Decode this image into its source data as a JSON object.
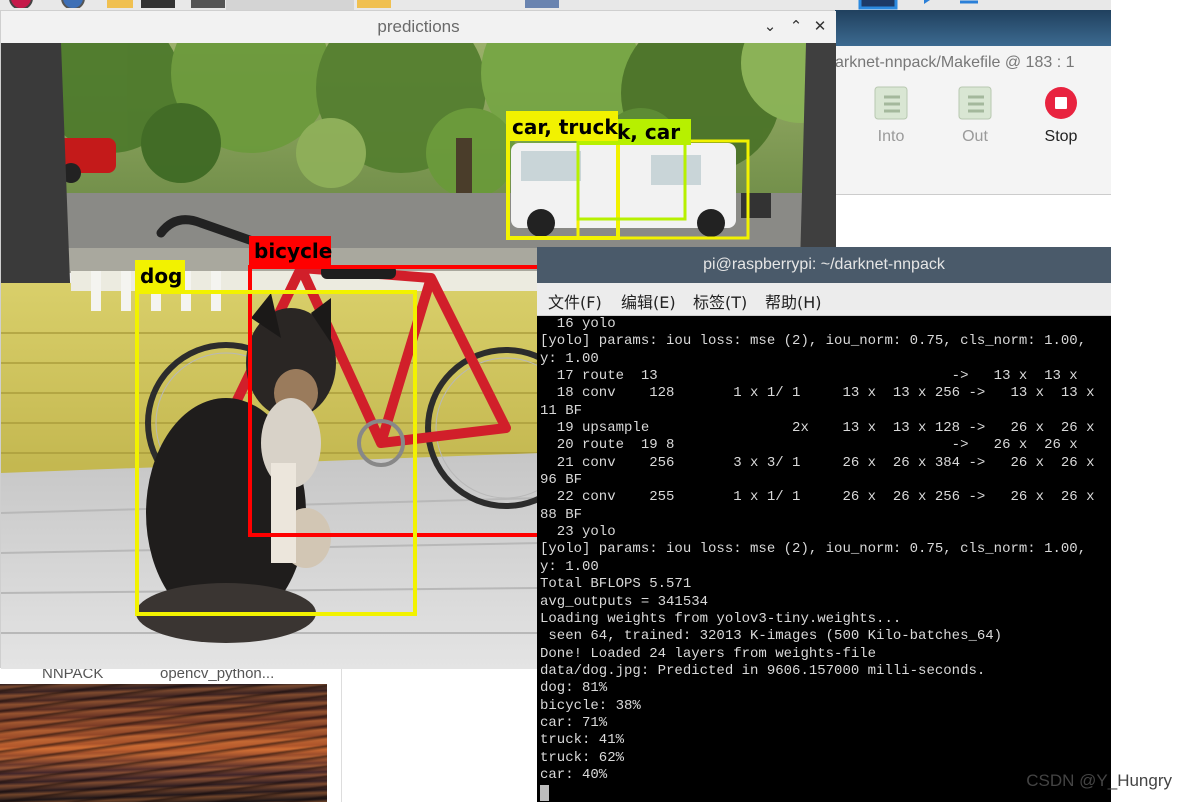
{
  "taskbar": {
    "icons": [
      "raspberry-icon",
      "globe-icon",
      "folder-icon",
      "terminal-icon",
      "terminal-icon",
      "folder-icon",
      "editor-icon",
      "geany-icon",
      "play-icon"
    ]
  },
  "predictions_window": {
    "title": "predictions",
    "controls": {
      "minimize": "⌄",
      "maximize": "⌃",
      "close": "✕"
    },
    "detections": [
      {
        "label": "car, truck",
        "color": "#f2f200"
      },
      {
        "label": "k, car",
        "color": "#b7f000"
      },
      {
        "label": "bicycle",
        "color": "#ff0000"
      },
      {
        "label": "dog",
        "color": "#f2f200"
      }
    ]
  },
  "ide": {
    "path": "arknet-nnpack/Makefile  @  183 : 1",
    "buttons": [
      {
        "label": "Into",
        "icon": "step-into-icon"
      },
      {
        "label": "Out",
        "icon": "step-out-icon"
      },
      {
        "label": "Stop",
        "icon": "stop-icon"
      }
    ],
    "stop_color": "#e8233f"
  },
  "desktop": {
    "labels": [
      "NNPACK",
      "opencv_python..."
    ],
    "marker": "///"
  },
  "terminal": {
    "title": "pi@raspberrypi: ~/darknet-nnpack",
    "menu": [
      "文件(F)",
      "编辑(E)",
      "标签(T)",
      "帮助(H)"
    ],
    "lines": [
      "  16 yolo",
      "[yolo] params: iou loss: mse (2), iou_norm: 0.75, cls_norm: 1.00,",
      "y: 1.00",
      "  17 route  13                                   ->   13 x  13 x",
      "  18 conv    128       1 x 1/ 1     13 x  13 x 256 ->   13 x  13 x",
      "11 BF",
      "  19 upsample                 2x    13 x  13 x 128 ->   26 x  26 x",
      "  20 route  19 8                                 ->   26 x  26 x",
      "  21 conv    256       3 x 3/ 1     26 x  26 x 384 ->   26 x  26 x",
      "96 BF",
      "  22 conv    255       1 x 1/ 1     26 x  26 x 256 ->   26 x  26 x",
      "88 BF",
      "  23 yolo",
      "[yolo] params: iou loss: mse (2), iou_norm: 0.75, cls_norm: 1.00,",
      "y: 1.00",
      "Total BFLOPS 5.571",
      "avg_outputs = 341534",
      "Loading weights from yolov3-tiny.weights...",
      " seen 64, trained: 32013 K-images (500 Kilo-batches_64)",
      "Done! Loaded 24 layers from weights-file",
      "data/dog.jpg: Predicted in 9606.157000 milli-seconds.",
      "dog: 81%",
      "bicycle: 38%",
      "car: 71%",
      "truck: 41%",
      "truck: 62%",
      "car: 40%"
    ]
  },
  "watermark": "CSDN @Y_Hungry"
}
